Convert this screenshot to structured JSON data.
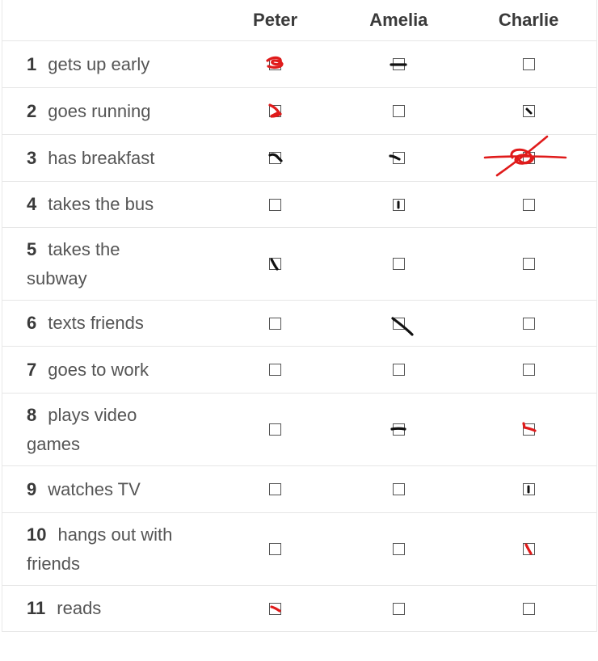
{
  "columns": [
    "Peter",
    "Amelia",
    "Charlie"
  ],
  "rows": [
    {
      "number": "1",
      "activity": "gets up early",
      "marks": [
        "red",
        "black",
        ""
      ]
    },
    {
      "number": "2",
      "activity": "goes running",
      "marks": [
        "red",
        "",
        "black"
      ]
    },
    {
      "number": "3",
      "activity": "has breakfast",
      "marks": [
        "black",
        "black",
        "red-crossed-out"
      ]
    },
    {
      "number": "4",
      "activity": "takes the bus",
      "marks": [
        "",
        "black",
        ""
      ]
    },
    {
      "number": "5",
      "activity": "takes the subway",
      "marks": [
        "black",
        "",
        ""
      ]
    },
    {
      "number": "6",
      "activity": "texts friends",
      "marks": [
        "",
        "black",
        ""
      ]
    },
    {
      "number": "7",
      "activity": "goes to work",
      "marks": [
        "",
        "",
        ""
      ]
    },
    {
      "number": "8",
      "activity": "plays video games",
      "marks": [
        "",
        "black",
        "red"
      ]
    },
    {
      "number": "9",
      "activity": "watches TV",
      "marks": [
        "",
        "",
        "black"
      ]
    },
    {
      "number": "10",
      "activity": "hangs out with friends",
      "marks": [
        "",
        "",
        "red"
      ]
    },
    {
      "number": "11",
      "activity": "reads",
      "marks": [
        "red",
        "",
        ""
      ]
    }
  ],
  "colors": {
    "red_ink": "#e01b1b",
    "black_ink": "#111111"
  }
}
